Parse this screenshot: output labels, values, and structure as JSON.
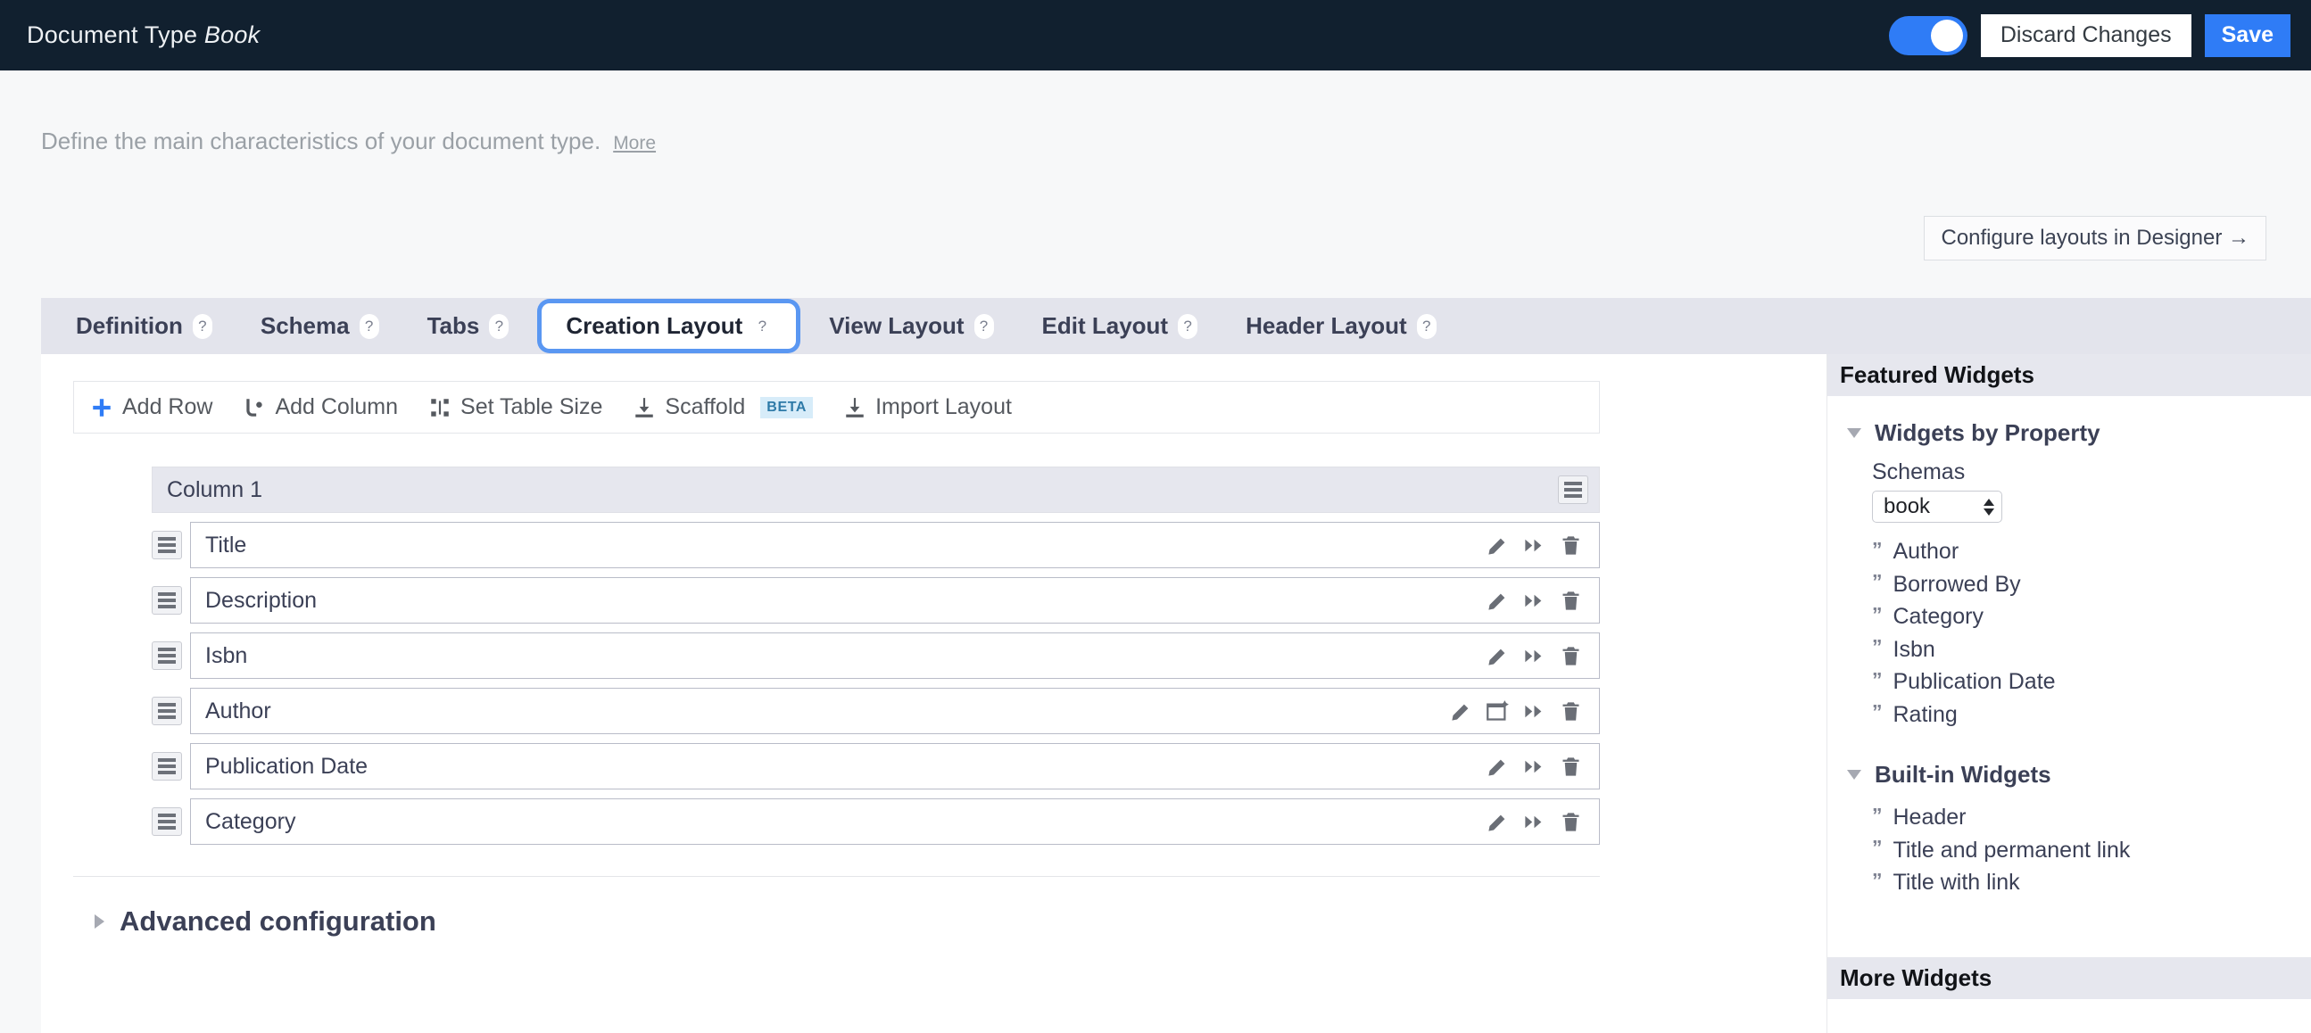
{
  "header": {
    "title_prefix": "Document Type",
    "title_name": "Book",
    "toggle_state": "on",
    "discard_label": "Discard Changes",
    "save_label": "Save",
    "accent_color": "#2f7cf6",
    "bar_color": "#11202f"
  },
  "page": {
    "subtitle": "Define the main characteristics of your document type.",
    "more_link": "More",
    "designer_button": "Configure layouts in Designer →"
  },
  "tabs": [
    {
      "label": "Definition",
      "help": "?",
      "active": false
    },
    {
      "label": "Schema",
      "help": "?",
      "active": false
    },
    {
      "label": "Tabs",
      "help": "?",
      "active": false
    },
    {
      "label": "Creation Layout",
      "help": "?",
      "active": true
    },
    {
      "label": "View Layout",
      "help": "?",
      "active": false
    },
    {
      "label": "Edit Layout",
      "help": "?",
      "active": false
    },
    {
      "label": "Header Layout",
      "help": "?",
      "active": false
    }
  ],
  "toolbar": [
    {
      "label": "Add Row",
      "icon": "plus-icon"
    },
    {
      "label": "Add Column",
      "icon": "add-column-icon"
    },
    {
      "label": "Set Table Size",
      "icon": "resize-table-icon"
    },
    {
      "label": "Scaffold",
      "icon": "download-icon",
      "badge": "BETA"
    },
    {
      "label": "Import Layout",
      "icon": "download-icon"
    }
  ],
  "layout_table": {
    "column_header": "Column 1",
    "column_handle_icon": "drag-handle-icon",
    "rows": [
      {
        "label": "Title",
        "actions": [
          "edit-icon",
          "move-icon",
          "delete-icon"
        ]
      },
      {
        "label": "Description",
        "actions": [
          "edit-icon",
          "move-icon",
          "delete-icon"
        ]
      },
      {
        "label": "Isbn",
        "actions": [
          "edit-icon",
          "move-icon",
          "delete-icon"
        ]
      },
      {
        "label": "Author",
        "actions": [
          "edit-icon",
          "open-window-icon",
          "move-icon",
          "delete-icon"
        ]
      },
      {
        "label": "Publication Date",
        "actions": [
          "edit-icon",
          "move-icon",
          "delete-icon"
        ]
      },
      {
        "label": "Category",
        "actions": [
          "edit-icon",
          "move-icon",
          "delete-icon"
        ]
      }
    ]
  },
  "advanced": {
    "label": "Advanced configuration",
    "expanded": false
  },
  "widgets_panel": {
    "title": "Featured Widgets",
    "footer": "More Widgets",
    "groups": [
      {
        "title": "Widgets by Property",
        "expanded": true,
        "field_label": "Schemas",
        "schema_value": "book",
        "schema_options": [
          "book"
        ],
        "items": [
          "Author",
          "Borrowed By",
          "Category",
          "Isbn",
          "Publication Date",
          "Rating"
        ]
      },
      {
        "title": "Built-in Widgets",
        "expanded": true,
        "items": [
          "Header",
          "Title and permanent link",
          "Title with link"
        ]
      }
    ]
  }
}
